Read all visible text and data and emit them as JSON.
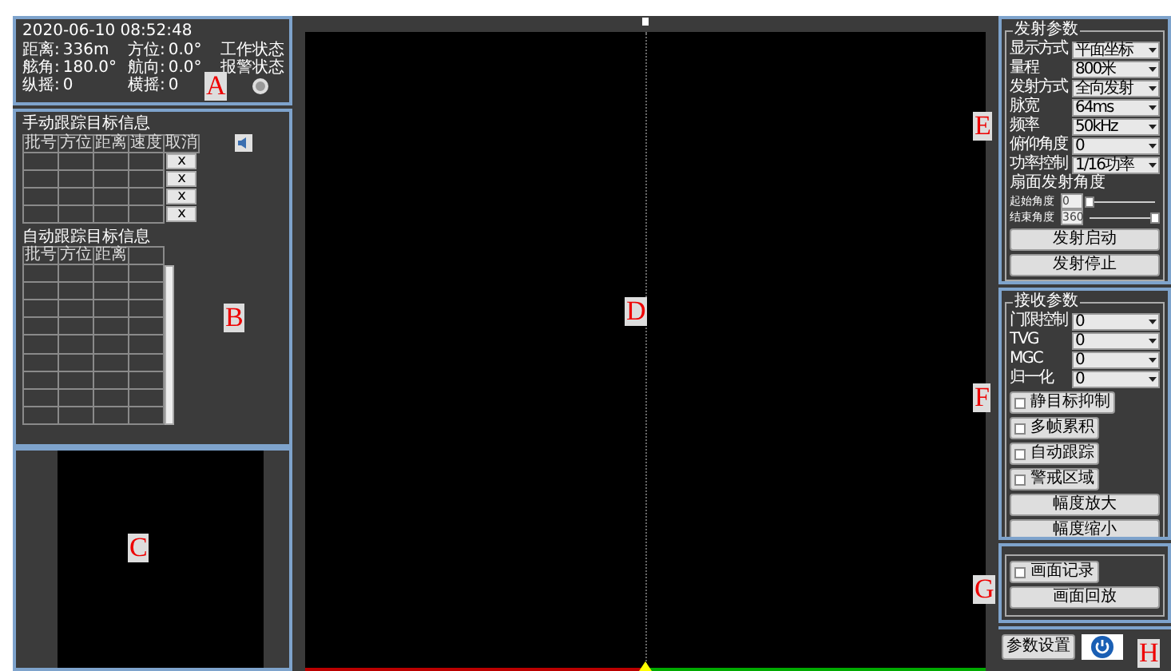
{
  "status": {
    "datetime": "2020-06-10 08:52:48",
    "fields": [
      {
        "label": "距离:",
        "value": "336m"
      },
      {
        "label": "方位:",
        "value": "0.0°"
      },
      {
        "label": "舷角:",
        "value": "180.0°"
      },
      {
        "label": "航向:",
        "value": "0.0°"
      },
      {
        "label": "纵摇:",
        "value": "0"
      },
      {
        "label": "横摇:",
        "value": "0"
      }
    ],
    "work_state": "工作状态",
    "alarm_state": "报警状态"
  },
  "manual_tracking": {
    "title": "手动跟踪目标信息",
    "columns": [
      "批号",
      "方位",
      "距离",
      "速度",
      "取消"
    ],
    "rows": [
      {
        "cancel": "x"
      },
      {
        "cancel": "x"
      },
      {
        "cancel": "x"
      },
      {
        "cancel": "x"
      }
    ]
  },
  "auto_tracking": {
    "title": "自动跟踪目标信息",
    "columns": [
      "批号",
      "方位",
      "距离",
      ""
    ]
  },
  "transmit": {
    "title": "发射参数",
    "fields": [
      {
        "label": "显示方式",
        "value": "平面坐标"
      },
      {
        "label": "量程",
        "value": "800米"
      },
      {
        "label": "发射方式",
        "value": "全向发射"
      },
      {
        "label": "脉宽",
        "value": "64ms"
      },
      {
        "label": "频率",
        "value": "50kHz"
      },
      {
        "label": "俯仰角度",
        "value": "0"
      },
      {
        "label": "功率控制",
        "value": "1/16功率"
      }
    ],
    "sector_title": "扇面发射角度",
    "sliders": [
      {
        "label": "起始角度",
        "value": "0",
        "level": 0
      },
      {
        "label": "结束角度",
        "value": "360",
        "level": 1
      }
    ],
    "buttons": [
      "发射启动",
      "发射停止"
    ]
  },
  "receive": {
    "title": "接收参数",
    "fields": [
      {
        "label": "门限控制",
        "value": "0"
      },
      {
        "label": "TVG",
        "value": "0"
      },
      {
        "label": "MGC",
        "value": "0"
      },
      {
        "label": "归一化",
        "value": "0"
      }
    ],
    "toggles": [
      {
        "label": "静目标抑制",
        "checked": false
      },
      {
        "label": "多帧累积",
        "checked": false
      },
      {
        "label": "自动跟踪",
        "checked": false
      },
      {
        "label": "警戒区域",
        "checked": false
      }
    ],
    "buttons": [
      "幅度放大",
      "幅度缩小"
    ]
  },
  "record": {
    "toggle": {
      "label": "画面记录",
      "checked": false
    },
    "button": "画面回放"
  },
  "footer": {
    "settings_button": "参数设置"
  },
  "annotations": [
    {
      "label": "A"
    },
    {
      "label": "B"
    },
    {
      "label": "C"
    },
    {
      "label": "D"
    },
    {
      "label": "E"
    },
    {
      "label": "F"
    },
    {
      "label": "G"
    },
    {
      "label": "H"
    }
  ]
}
